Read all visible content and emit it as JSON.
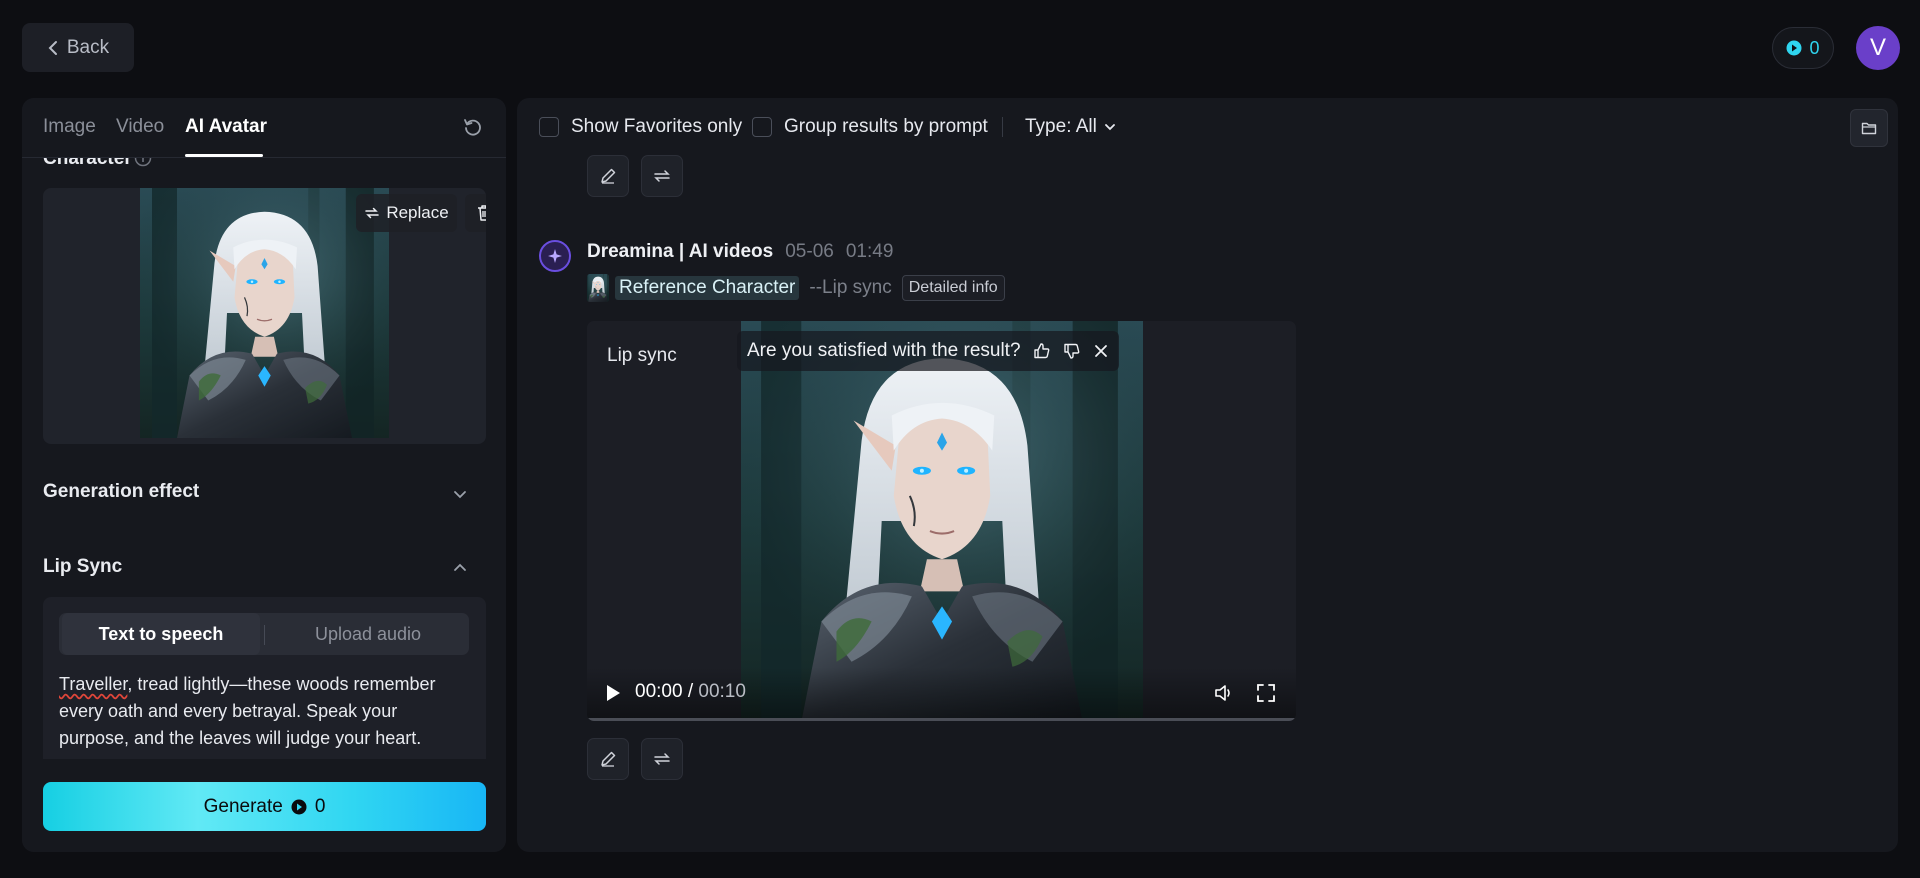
{
  "topbar": {
    "back_label": "Back",
    "credits": "0",
    "avatar_initial": "V"
  },
  "left_panel": {
    "tabs": [
      {
        "label": "Image",
        "active": false
      },
      {
        "label": "Video",
        "active": false
      },
      {
        "label": "AI Avatar",
        "active": true
      }
    ],
    "character": {
      "title": "Character",
      "replace_label": "Replace"
    },
    "generation_effect": {
      "title": "Generation effect"
    },
    "lip_sync": {
      "title": "Lip Sync",
      "modes": [
        "Text to speech",
        "Upload audio"
      ],
      "selected_mode": "Text to speech",
      "text_first_word": "Traveller",
      "text_rest": ", tread lightly—these woods remember every oath and every betrayal. Speak your purpose, and the leaves will judge your heart."
    },
    "generate": {
      "label": "Generate",
      "cost": "0"
    }
  },
  "right_panel": {
    "filters": {
      "favorites_label": "Show Favorites only",
      "favorites_checked": false,
      "group_label": "Group results by prompt",
      "group_checked": false,
      "type_label": "Type: All"
    },
    "result": {
      "title": "Dreamina | AI videos",
      "date": "05-06",
      "time": "01:49",
      "reference_label": "Reference Character",
      "mode_tag": "--Lip sync",
      "detail_label": "Detailed info",
      "video": {
        "label": "Lip sync",
        "feedback_question": "Are you satisfied with the result?",
        "current_time": "00:00",
        "duration": "00:10",
        "progress": 0
      }
    }
  },
  "colors": {
    "accent_cyan": "#2fd5ef",
    "avatar_purple": "#6a3fc9",
    "panel_bg": "#16181e",
    "page_bg": "#0d0e12"
  }
}
